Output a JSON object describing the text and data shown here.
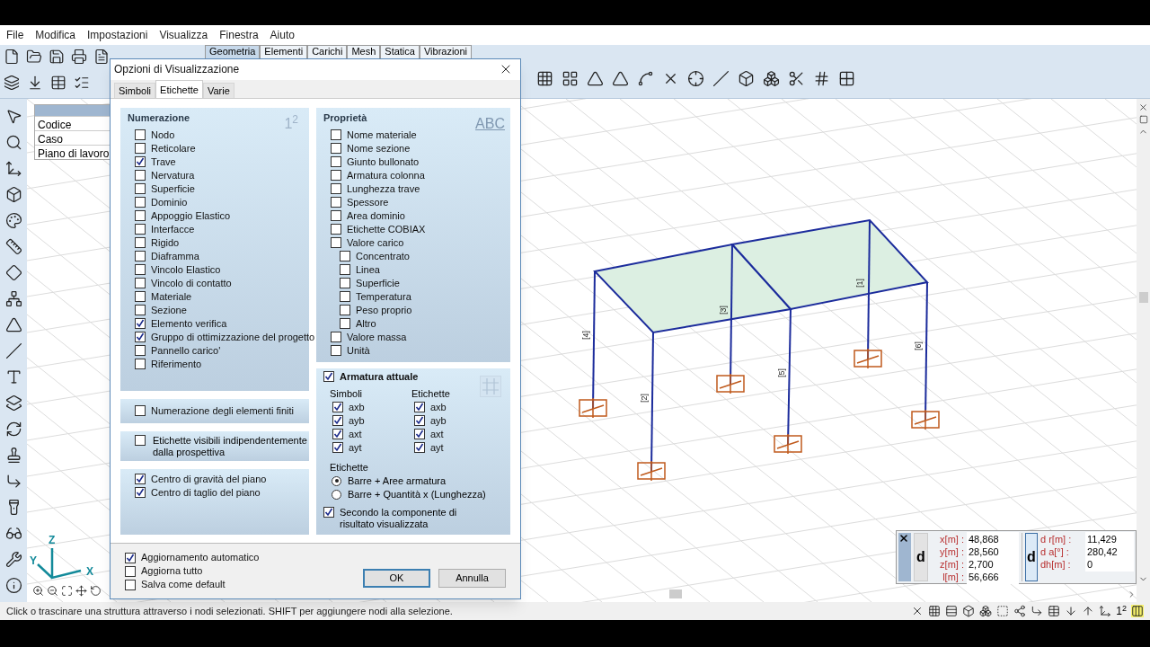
{
  "menu": [
    "File",
    "Modifica",
    "Impostazioni",
    "Visualizza",
    "Finestra",
    "Aiuto"
  ],
  "ribbon_tabs": [
    {
      "label": "Geometria",
      "selected": true
    },
    {
      "label": "Elementi",
      "selected": false
    },
    {
      "label": "Carichi",
      "selected": false
    },
    {
      "label": "Mesh",
      "selected": false
    },
    {
      "label": "Statica",
      "selected": false
    },
    {
      "label": "Vibrazioni",
      "selected": false
    }
  ],
  "side_table": [
    "Codice",
    "Caso",
    "Piano di lavoro"
  ],
  "dialog": {
    "title": "Opzioni di Visualizzazione",
    "tabs": [
      {
        "label": "Simboli",
        "selected": false
      },
      {
        "label": "Etichette",
        "selected": true
      },
      {
        "label": "Varie",
        "selected": false
      }
    ],
    "numerazione": {
      "title": "Numerazione",
      "glyph": "1$^{2}$",
      "items": [
        {
          "label": "Nodo",
          "checked": false
        },
        {
          "label": "Reticolare",
          "checked": false
        },
        {
          "label": "Trave",
          "checked": true
        },
        {
          "label": "Nervatura",
          "checked": false
        },
        {
          "label": "Superficie",
          "checked": false
        },
        {
          "label": "Dominio",
          "checked": false
        },
        {
          "label": "Appoggio Elastico",
          "checked": false
        },
        {
          "label": "Interfacce",
          "checked": false
        },
        {
          "label": "Rigido",
          "checked": false
        },
        {
          "label": "Diaframma",
          "checked": false
        },
        {
          "label": "Vincolo Elastico",
          "checked": false
        },
        {
          "label": "Vincolo di contatto",
          "checked": false
        },
        {
          "label": "Materiale",
          "checked": false
        },
        {
          "label": "Sezione",
          "checked": false
        },
        {
          "label": "Elemento verifica",
          "checked": true
        },
        {
          "label": "Gruppo di ottimizzazione del progetto",
          "checked": true
        },
        {
          "label": "Pannello carico'",
          "checked": false
        },
        {
          "label": "Riferimento",
          "checked": false
        }
      ]
    },
    "fem_numbering": {
      "label": "Numerazione degli elementi finiti",
      "checked": false
    },
    "labels_independent": {
      "label": "Etichette visibili indipendentemente dalla prospettiva",
      "checked": false
    },
    "centers": [
      {
        "label": "Centro di gravità del piano",
        "checked": true
      },
      {
        "label": "Centro di taglio del piano",
        "checked": true
      }
    ],
    "proprieta": {
      "title": "Proprietà",
      "glyph": "ABC",
      "items": [
        {
          "label": "Nome materiale",
          "checked": false
        },
        {
          "label": "Nome sezione",
          "checked": false
        },
        {
          "label": "Giunto bullonato",
          "checked": false
        },
        {
          "label": "Armatura colonna",
          "checked": false
        },
        {
          "label": "Lunghezza trave",
          "checked": false
        },
        {
          "label": "Spessore",
          "checked": false
        },
        {
          "label": "Area dominio",
          "checked": false
        },
        {
          "label": "Etichette COBIAX",
          "checked": false
        },
        {
          "label": "Valore carico",
          "checked": false,
          "children": [
            {
              "label": "Concentrato",
              "checked": false
            },
            {
              "label": "Linea",
              "checked": false
            },
            {
              "label": "Superficie",
              "checked": false
            },
            {
              "label": "Temperatura",
              "checked": false
            },
            {
              "label": "Peso proprio",
              "checked": false
            },
            {
              "label": "Altro",
              "checked": false
            }
          ]
        },
        {
          "label": "Valore massa",
          "checked": false
        },
        {
          "label": "Unità",
          "checked": false
        }
      ]
    },
    "armatura": {
      "label": "Armatura attuale",
      "checked": true,
      "simboli": {
        "title": "Simboli",
        "items": [
          {
            "label": "axb",
            "checked": true
          },
          {
            "label": "ayb",
            "checked": true
          },
          {
            "label": "axt",
            "checked": true
          },
          {
            "label": "ayt",
            "checked": true
          }
        ]
      },
      "etichette": {
        "title": "Etichette",
        "items": [
          {
            "label": "axb",
            "checked": true
          },
          {
            "label": "ayb",
            "checked": true
          },
          {
            "label": "axt",
            "checked": true
          },
          {
            "label": "ayt",
            "checked": true
          }
        ]
      },
      "mode_title": "Etichette",
      "modes": [
        {
          "label": "Barre + Aree armatura",
          "selected": true
        },
        {
          "label": "Barre + Quantità x (Lunghezza)",
          "selected": false
        }
      ],
      "component": {
        "label": "Secondo la componente di risultato visualizzata",
        "checked": true
      }
    },
    "footer_options": [
      {
        "label": "Aggiornamento automatico",
        "checked": true
      },
      {
        "label": "Aggiorna tutto",
        "checked": false
      },
      {
        "label": "Salva come default",
        "checked": false
      }
    ],
    "buttons": [
      {
        "label": "OK",
        "kind": "default"
      },
      {
        "label": "Annulla",
        "kind": "normal"
      }
    ]
  },
  "coordinates": {
    "left_button": "d",
    "left": [
      {
        "label": "x[m] :",
        "value": "48,868"
      },
      {
        "label": "y[m] :",
        "value": "28,560"
      },
      {
        "label": "z[m] :",
        "value": "2,700"
      },
      {
        "label": "l[m] :",
        "value": "56,666"
      }
    ],
    "right_button": "d",
    "right": [
      {
        "label": "d r[m] :",
        "value": "11,429"
      },
      {
        "label": "d a[°] :",
        "value": "280,42"
      },
      {
        "label": "dh[m] :",
        "value": "0"
      }
    ]
  },
  "axes": [
    "Z",
    "Y",
    "X"
  ],
  "member_labels": [
    "[4]",
    "[1]",
    "[5]",
    "[2]",
    "[6]",
    "[3]"
  ],
  "status": {
    "text": "Click o trascinare una struttura attraverso i nodi selezionati. SHIFT per aggiungere nodi alla selezione.",
    "glyph": "1$^{2}$"
  }
}
